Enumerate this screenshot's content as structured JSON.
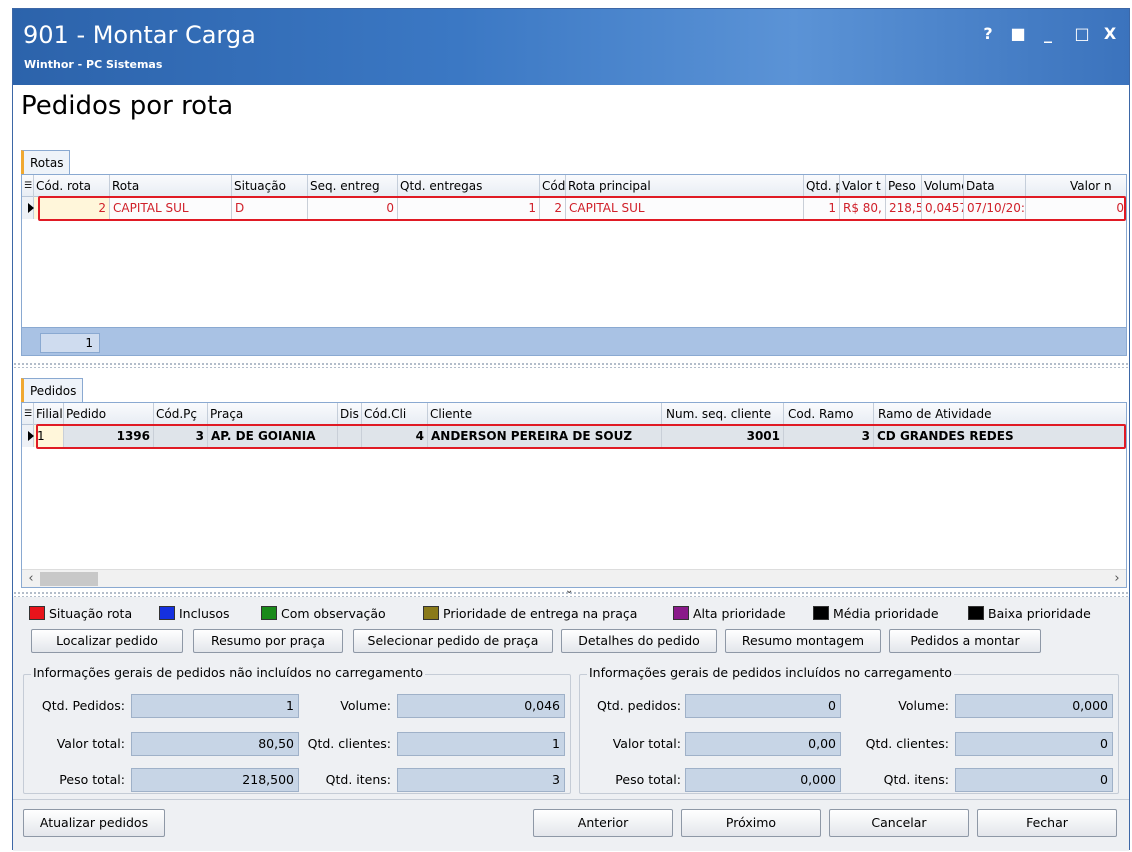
{
  "window": {
    "title": "901 - Montar Carga",
    "subtitle": "Winthor - PC Sistemas",
    "controls": [
      "?",
      "■",
      "_",
      "□",
      "X"
    ]
  },
  "page_title": "Pedidos por rota",
  "rotas": {
    "tab_label": "Rotas",
    "columns": [
      "Cód. rota",
      "Rota",
      "Situação",
      "Seq. entreg",
      "Qtd. entregas",
      "Cód",
      "Rota principal",
      "Qtd. p",
      "Valor t",
      "Peso",
      "Volume",
      "Data",
      "Valor n"
    ],
    "rows": [
      {
        "cod_rota": "2",
        "rota": "CAPITAL SUL",
        "situacao": "D",
        "seq_entrega": "0",
        "qtd_entregas": "1",
        "cod": "2",
        "rota_principal": "CAPITAL SUL",
        "qtd_p": "1",
        "valor_t": "R$ 80,",
        "peso": "218,5",
        "volume": "0,0457",
        "data": "07/10/20:",
        "valor_n": "0"
      }
    ],
    "footer_count": "1"
  },
  "pedidos": {
    "tab_label": "Pedidos",
    "columns": [
      "Filial",
      "Pedido",
      "Cód.Pç",
      "Praça",
      "Dis",
      "Cód.Cli",
      "Cliente",
      "Num. seq. cliente",
      "Cod. Ramo",
      "Ramo de Atividade"
    ],
    "rows": [
      {
        "filial": "1",
        "pedido": "1396",
        "cod_praca": "3",
        "praca": "AP. DE GOIANIA",
        "dis": "",
        "cod_cli": "4",
        "cliente": "ANDERSON PEREIRA DE SOUZ",
        "num_seq_cliente": "3001",
        "cod_ramo": "3",
        "ramo_atividade": "CD GRANDES REDES"
      }
    ]
  },
  "legend": [
    {
      "label": "Situação rota",
      "color": "#e8141b"
    },
    {
      "label": "Inclusos",
      "color": "#1530e0"
    },
    {
      "label": "Com observação",
      "color": "#1a8a1a"
    },
    {
      "label": "Prioridade de entrega na praça",
      "color": "#8a7a1a"
    },
    {
      "label": "Alta prioridade",
      "color": "#8a1a8a"
    },
    {
      "label": "Média prioridade",
      "color": "#000000"
    },
    {
      "label": "Baixa prioridade",
      "color": "#000000"
    }
  ],
  "actions": {
    "localizar": "Localizar pedido",
    "resumo_praca": "Resumo por praça",
    "selecionar_praca": "Selecionar pedido de praça",
    "detalhes": "Detalhes do pedido",
    "resumo_montagem": "Resumo montagem",
    "pedidos_montar": "Pedidos a montar"
  },
  "nao_incluidos": {
    "title": "Informações gerais de pedidos não incluídos no carregamento",
    "qtd_pedidos_label": "Qtd. Pedidos:",
    "qtd_pedidos": "1",
    "volume_label": "Volume:",
    "volume": "0,046",
    "valor_total_label": "Valor total:",
    "valor_total": "80,50",
    "qtd_clientes_label": "Qtd. clientes:",
    "qtd_clientes": "1",
    "peso_total_label": "Peso total:",
    "peso_total": "218,500",
    "qtd_itens_label": "Qtd. itens:",
    "qtd_itens": "3"
  },
  "incluidos": {
    "title": "Informações gerais de pedidos incluídos no carregamento",
    "qtd_pedidos_label": "Qtd. pedidos:",
    "qtd_pedidos": "0",
    "volume_label": "Volume:",
    "volume": "0,000",
    "valor_total_label": "Valor total:",
    "valor_total": "0,00",
    "qtd_clientes_label": "Qtd. clientes:",
    "qtd_clientes": "0",
    "peso_total_label": "Peso total:",
    "peso_total": "0,000",
    "qtd_itens_label": "Qtd. itens:",
    "qtd_itens": "0"
  },
  "bottom": {
    "atualizar": "Atualizar pedidos",
    "anterior": "Anterior",
    "proximo": "Próximo",
    "cancelar": "Cancelar",
    "fechar": "Fechar"
  }
}
